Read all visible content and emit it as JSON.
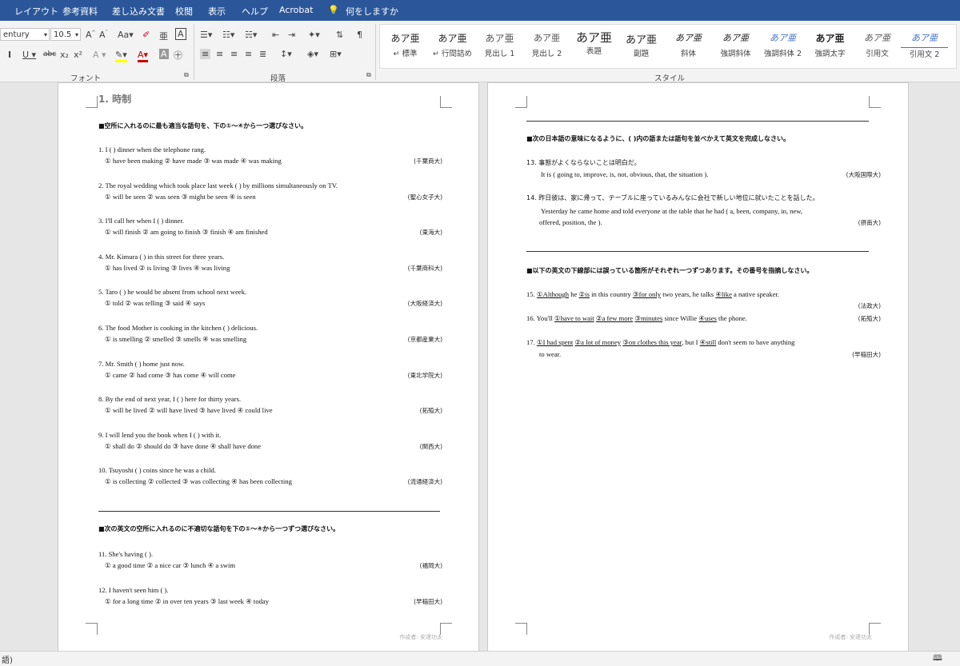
{
  "menu_tabs": [
    "レイアウト",
    "参考資料",
    "差し込み文書",
    "校閲",
    "表示",
    "ヘルプ",
    "Acrobat",
    "何をしますか"
  ],
  "font": {
    "name": "entury",
    "size": "10.5",
    "group_label": "フォント"
  },
  "paragraph_group_label": "段落",
  "styles_group_label": "スタイル",
  "styles": [
    {
      "preview": "あア亜",
      "name": "↵ 標準"
    },
    {
      "preview": "あア亜",
      "name": "↵ 行間詰め"
    },
    {
      "preview": "あア亜",
      "name": "見出し 1"
    },
    {
      "preview": "あア亜",
      "name": "見出し 2"
    },
    {
      "preview": "あア亜",
      "name": "表題"
    },
    {
      "preview": "あア亜",
      "name": "副題"
    },
    {
      "preview": "あア亜",
      "name": "斜体"
    },
    {
      "preview": "あア亜",
      "name": "強調斜体"
    },
    {
      "preview": "あア亜",
      "name": "強調斜体 2"
    },
    {
      "preview": "あア亜",
      "name": "強調太字"
    },
    {
      "preview": "あア亜",
      "name": "引用文"
    },
    {
      "preview": "あア亜",
      "name": "引用文 2"
    }
  ],
  "page1": {
    "heading": "1. 時制",
    "instruction1": "■空所に入れるのに最も適当な語句を、下の①～④から一つ選びなさい。",
    "questions": [
      {
        "q": "1. I (        ) dinner when the telephone rang.",
        "opts": "①  have been making   ②  have made   ③  was made   ④  was making",
        "src": "(千葉商大)"
      },
      {
        "q": "2. The royal wedding which took place last week (        ) by millions simultaneously on TV.",
        "opts": "①  will be seen   ②  was seen   ③  might be seen   ④  is seen",
        "src": "(聖心女子大)"
      },
      {
        "q": "3. I'll call her when I (        ) dinner.",
        "opts": "①  will finish   ②  am going to finish   ③  finish   ④  am finished",
        "src": "(東海大)"
      },
      {
        "q": "4. Mr. Kimura (        ) in this street for three years.",
        "opts": "①  has lived   ②  is living   ③  lives   ④  was living",
        "src": "(千葉商科大)"
      },
      {
        "q": "5. Taro (        ) he would be absent from school next week.",
        "opts": "①  told   ②  was telling   ③  said   ④  says",
        "src": "(大阪経済大)"
      },
      {
        "q": "6. The food Mother is cooking in the kitchen (        ) delicious.",
        "opts": "①  is smelling   ②  smelled   ③  smells  ④  was smelling",
        "src": "(京都産業大)"
      },
      {
        "q": "7. Mr. Smith (        ) home just now.",
        "opts": "①  came   ②  had come   ③  has come   ④  will come",
        "src": "(東北学院大)"
      },
      {
        "q": "8. By the end of next year, I (        ) here for thirty years.",
        "opts": "①  will be lived   ②  will have lived   ③  have lived   ④  could live",
        "src": "(拓殖大)"
      },
      {
        "q": "9. I will lend you the book when I (        ) with it.",
        "opts": "①  shall do   ②  should do   ③  have done   ④  shall have done",
        "src": "(関西大)"
      },
      {
        "q": "10. Tsuyoshi (        ) coins since he was a child.",
        "opts": "①  is collecting   ②  collected   ③  was collecting   ④  has been collecting",
        "src": "(流通経済大)"
      }
    ],
    "instruction2": "■次の英文の空所に入れるのに不適切な語句を下の①～④から一つずつ選びなさい。",
    "questions2": [
      {
        "q": "11. She's having (        ).",
        "opts": "①   a good time   ②  a nice car   ③  lunch   ④  a swim",
        "src": "(福岡大)"
      },
      {
        "q": "12. I haven't seen him (        ).",
        "opts": "①   for a long time   ②  in over ten years   ③  last week   ④  today",
        "src": "(早稲田大)"
      }
    ],
    "footer": "作成者: 安達功太"
  },
  "page2": {
    "instruction3": "■次の日本語の意味になるように、(    )内の語または語句を並べかえて英文を完成しなさい。",
    "q13_jp": "13. 事態がよくならないことは明白だ。",
    "q13_en": "It is ( going to, improve, is, not, obvious, that, the situation ).",
    "q13_src": "(大阪国際大)",
    "q14_jp": "14. 昨日彼は、家に帰って、テーブルに座っているみんなに会社で新しい地位に就いたことを話した。",
    "q14_en1": "Yesterday he came home and told everyone at the table that he had ( a, been, company, in, new,",
    "q14_en2": "offered, position, the ).",
    "q14_src": "(摂南大)",
    "instruction4": "■以下の英文の下線部には誤っている箇所がそれぞれ一つずつあります。その番号を指摘しなさい。",
    "q15": {
      "num": "15.",
      "p1": "①Although",
      "t1": " he ",
      "p2": "②is",
      "t2": " in this country ",
      "p3": "③for only",
      "t3": " two years, he talks ",
      "p4": "④like",
      "t4": " a native speaker.",
      "src": "(法政大)"
    },
    "q16": {
      "num": "16. You'll ",
      "p1": "①have to wait",
      "t1": " ",
      "p2": "②a few more",
      "t2": " ",
      "p3": "③minutes",
      "t3": " since Willie ",
      "p4": "④uses",
      "t4": " the phone.",
      "src": "(拓殖大)"
    },
    "q17": {
      "num": "17. ",
      "p1": "①I had spent",
      "t1": " ",
      "p2": "②a lot of money",
      "t2": " ",
      "p3": "③on clothes this year",
      "t3": ", but I ",
      "p4": "④still",
      "t4": " don't seem to have anything",
      "line2": "to wear.",
      "src": "(早稲田大)"
    },
    "footer": "作成者: 安達功太"
  },
  "status": {
    "left": "語)",
    "right": "🕮"
  }
}
